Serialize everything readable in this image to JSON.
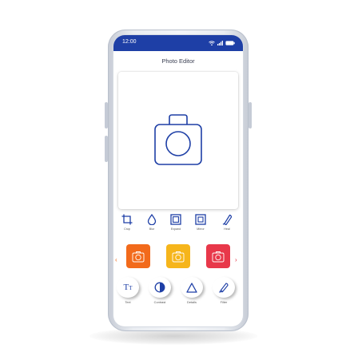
{
  "status": {
    "time": "12:00"
  },
  "header": {
    "title": "Photo Editor"
  },
  "tools": [
    {
      "icon": "crop-icon",
      "label": "Crop"
    },
    {
      "icon": "blur-icon",
      "label": "Blur"
    },
    {
      "icon": "expand-icon",
      "label": "Expand"
    },
    {
      "icon": "mirror-icon",
      "label": "Mirror"
    },
    {
      "icon": "heal-icon",
      "label": "Heal"
    }
  ],
  "filters": [
    {
      "name": "orange-filter",
      "color": "#f26a1b"
    },
    {
      "name": "yellow-filter",
      "color": "#f6b51b"
    },
    {
      "name": "red-filter",
      "color": "#e8384a"
    }
  ],
  "adjustments": [
    {
      "icon": "text-icon",
      "label": "Text"
    },
    {
      "icon": "contrast-icon",
      "label": "Contrast"
    },
    {
      "icon": "details-icon",
      "label": "Details"
    },
    {
      "icon": "filter-icon",
      "label": "Filter"
    }
  ],
  "colors": {
    "accent": "#1e3fa6",
    "icon": "#1e3fa6",
    "filter_arrow": "#f26a1b"
  }
}
